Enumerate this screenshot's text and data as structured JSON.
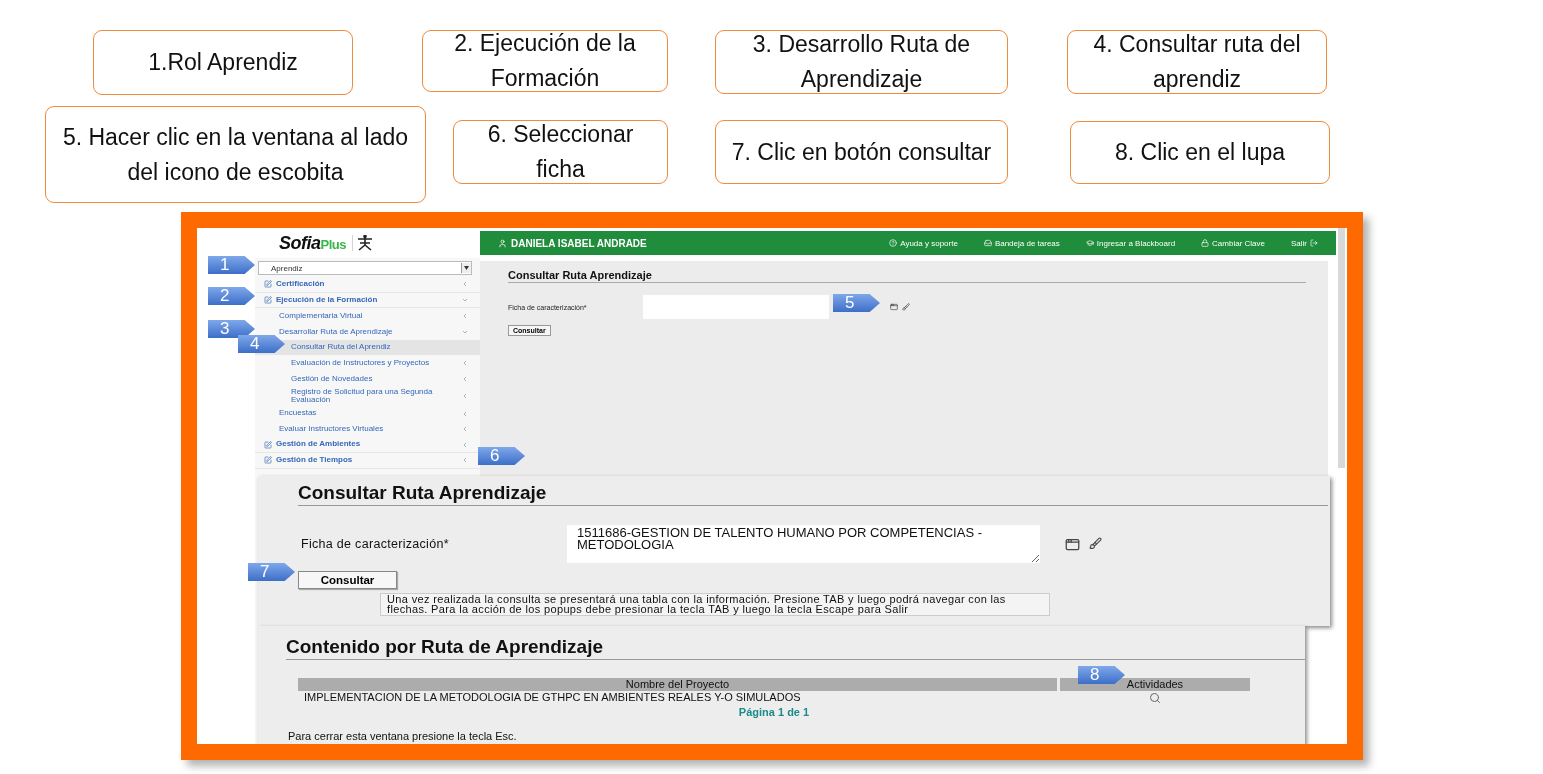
{
  "steps": [
    {
      "number": "1",
      "text": "1.Rol Aprendiz"
    },
    {
      "number": "2",
      "text": "2. Ejecución de la Formación"
    },
    {
      "number": "3",
      "text": "3. Desarrollo Ruta de Aprendizaje"
    },
    {
      "number": "4",
      "text": "4. Consultar ruta del aprendiz"
    },
    {
      "number": "5",
      "text": "5. Hacer clic en la ventana al lado del icono de escobita"
    },
    {
      "number": "6",
      "text": "6. Seleccionar ficha"
    },
    {
      "number": "7",
      "text": "7. Clic en botón consultar"
    },
    {
      "number": "8",
      "text": "8. Clic en el lupa"
    }
  ],
  "app": {
    "logo": {
      "name": "Sofia",
      "suffix": "Plus"
    },
    "role_select": {
      "value": "Aprendiz"
    },
    "menu": [
      {
        "label": "Certificación",
        "expanded": false,
        "selected": false
      },
      {
        "label": "Ejecución de la Formación",
        "expanded": true,
        "selected": false,
        "children": [
          {
            "label": "Complementaria Virtual",
            "expanded": false,
            "selected": false
          },
          {
            "label": "Desarrollar Ruta de Aprendizaje",
            "expanded": true,
            "selected": false,
            "children": [
              {
                "label": "Consultar Ruta del Aprendiz",
                "selected": true
              },
              {
                "label": "Evaluación de Instructores y Proyectos",
                "expanded": false,
                "selected": false
              },
              {
                "label": "Gestión de Novedades",
                "expanded": false,
                "selected": false
              },
              {
                "label": "Registro de Solicitud para una Segunda Evaluación",
                "expanded": false,
                "selected": false
              }
            ]
          },
          {
            "label": "Encuestas",
            "expanded": false,
            "selected": false
          },
          {
            "label": "Evaluar Instructores Virtuales",
            "expanded": false,
            "selected": false
          }
        ]
      },
      {
        "label": "Gestión de Ambientes",
        "expanded": false,
        "selected": false
      },
      {
        "label": "Gestión de Tiempos",
        "expanded": false,
        "selected": false
      }
    ],
    "user": "DANIELA ISABEL ANDRADE",
    "top_links": [
      "Ayuda y soporte",
      "Bandeja de tareas",
      "Ingresar a Blackboard",
      "Cambiar Clave",
      "Salir"
    ],
    "form": {
      "title": "Consultar Ruta Aprendizaje",
      "field_label": "Ficha de caracterización*",
      "button": "Consultar"
    }
  },
  "zoom_form": {
    "title": "Consultar Ruta Aprendizaje",
    "field_label": "Ficha de caracterización*",
    "value": "1511686-GESTION DE TALENTO HUMANO POR COMPETENCIAS - METODOLOGIA",
    "button": "Consultar",
    "help": "Una vez realizada la consulta se presentará una tabla con la información. Presione TAB y luego podrá navegar con las flechas. Para la acción de los popups debe presionar la tecla TAB y luego la tecla Escape para Salir"
  },
  "results": {
    "title": "Contenido por Ruta de Aprendizaje",
    "columns": [
      "Nombre del Proyecto",
      "Actividades"
    ],
    "rows": [
      {
        "name": "IMPLEMENTACION DE LA METODOLOGIA DE GTHPC EN AMBIENTES REALES Y-O SIMULADOS"
      }
    ],
    "pager": "Página 1 de 1",
    "note": "Para cerrar esta ventana presione la tecla Esc."
  }
}
